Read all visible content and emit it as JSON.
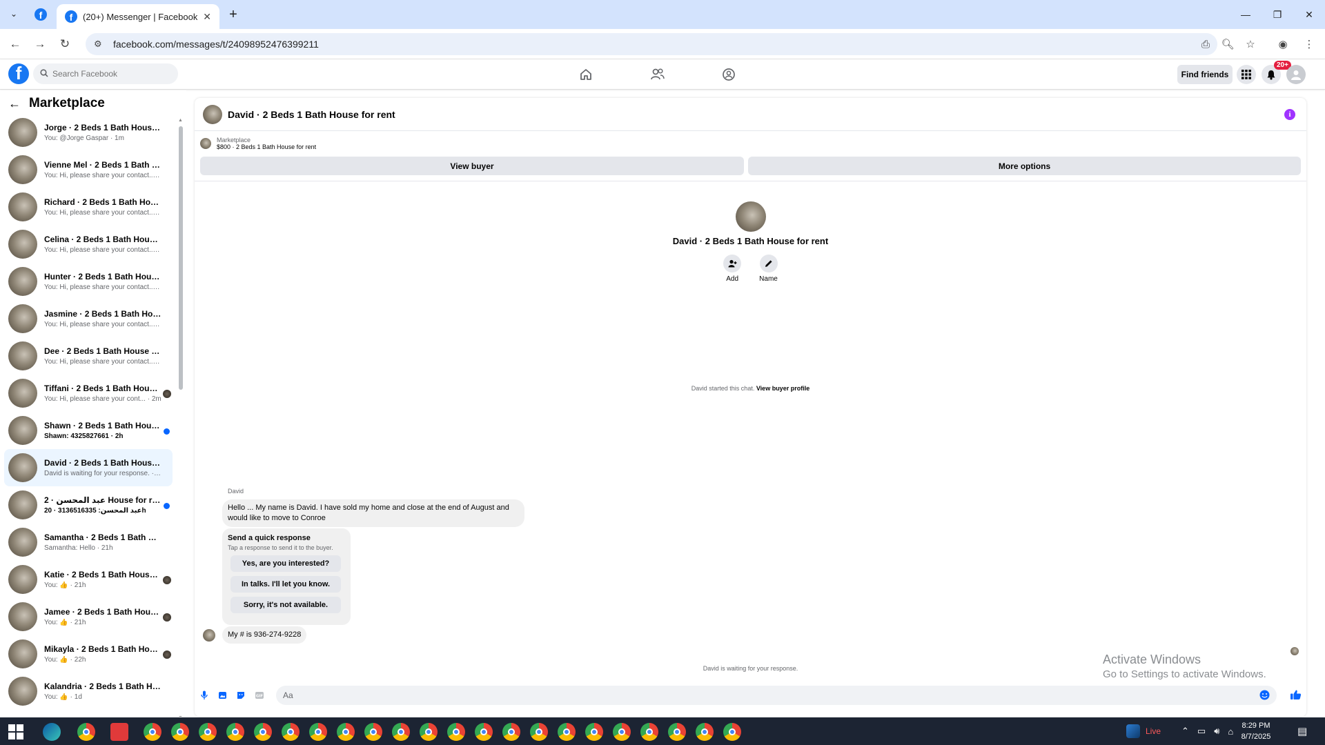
{
  "browser": {
    "tab_title": "(20+) Messenger | Facebook",
    "url": "facebook.com/messages/t/24098952476399211"
  },
  "facebook": {
    "search_placeholder": "Search Facebook",
    "find_friends": "Find friends",
    "notifications_badge": "20+",
    "brand_color": "#1877f2"
  },
  "sidebar": {
    "title": "Marketplace",
    "conversations": [
      {
        "name": "Jorge · 2 Beds 1 Bath House for ...",
        "preview": "You: @Jorge Gaspar · 1m",
        "status": "none"
      },
      {
        "name": "Vienne Mel · 2 Beds 1 Bath Hou...",
        "preview": "You: Hi, please share your contact... · 2m",
        "status": "none"
      },
      {
        "name": "Richard · 2 Beds 1 Bath House f...",
        "preview": "You: Hi, please share your contact... · 2m",
        "status": "none"
      },
      {
        "name": "Celina · 2 Beds 1 Bath House for...",
        "preview": "You: Hi, please share your contact... · 2m",
        "status": "none"
      },
      {
        "name": "Hunter · 2 Beds 1 Bath House fo...",
        "preview": "You: Hi, please share your contact... · 2m",
        "status": "none"
      },
      {
        "name": "Jasmine · 2 Beds 1 Bath House f...",
        "preview": "You: Hi, please share your contact... · 2m",
        "status": "none"
      },
      {
        "name": "Dee · 2 Beds 1 Bath House for r...",
        "preview": "You: Hi, please share your contact... · 2m",
        "status": "none"
      },
      {
        "name": "Tiffani · 2 Beds 1 Bath House ...",
        "preview": "You: Hi, please share your cont... · 2m",
        "status": "seen"
      },
      {
        "name": "Shawn · 2 Beds 1 Bath House f...",
        "preview": "Shawn: 4325827661 · 2h",
        "status": "unread"
      },
      {
        "name": "David · 2 Beds 1 Bath House for...",
        "preview": "David is waiting for your response. · 10h",
        "status": "active"
      },
      {
        "name": "عبد المحسن · 2 House for rent ...",
        "preview": "عبد المحسن: 3136516335 · 20h",
        "status": "unread"
      },
      {
        "name": "Samantha · 2 Beds 1 Bath Hous...",
        "preview": "Samantha: Hello · 21h",
        "status": "none"
      },
      {
        "name": "Katie · 2 Beds 1 Bath House f...",
        "preview": "You: 👍 · 21h",
        "status": "seen"
      },
      {
        "name": "Jamee · 2 Beds 1 Bath House ...",
        "preview": "You: 👍 · 21h",
        "status": "seen"
      },
      {
        "name": "Mikayla · 2 Beds 1 Bath Hous...",
        "preview": "You: 👍 · 22h",
        "status": "seen"
      },
      {
        "name": "Kalandria · 2 Beds 1 Bath House...",
        "preview": "You: 👍 · 1d",
        "status": "none"
      }
    ]
  },
  "chat": {
    "title": "David · 2 Beds 1 Bath House for rent",
    "listing_source": "Marketplace",
    "listing_price": "$800 · 2 Beds 1 Bath House for rent",
    "view_buyer": "View buyer",
    "more_options": "More options",
    "profile_name": "David · 2 Beds 1 Bath House for rent",
    "add_label": "Add",
    "name_label": "Name",
    "started_text": "David started this chat.",
    "view_buyer_profile": "View buyer profile",
    "sender": "David",
    "message1": "Hello ... My name is David. I have sold my home and close at the end of August and would like to move to Conroe",
    "quick_title": "Send a quick response",
    "quick_sub": "Tap a response to send it to the buyer.",
    "quick_options": [
      "Yes, are you interested?",
      "In talks. I'll let you know.",
      "Sorry, it's not available."
    ],
    "message2": "My # is 936-274-9228",
    "waiting": "David is waiting for your response.",
    "composer_placeholder": "Aa"
  },
  "watermark": {
    "line1": "Activate Windows",
    "line2": "Go to Settings to activate Windows."
  },
  "taskbar": {
    "live": "Live",
    "time": "8:29 PM",
    "date": "8/7/2025"
  }
}
